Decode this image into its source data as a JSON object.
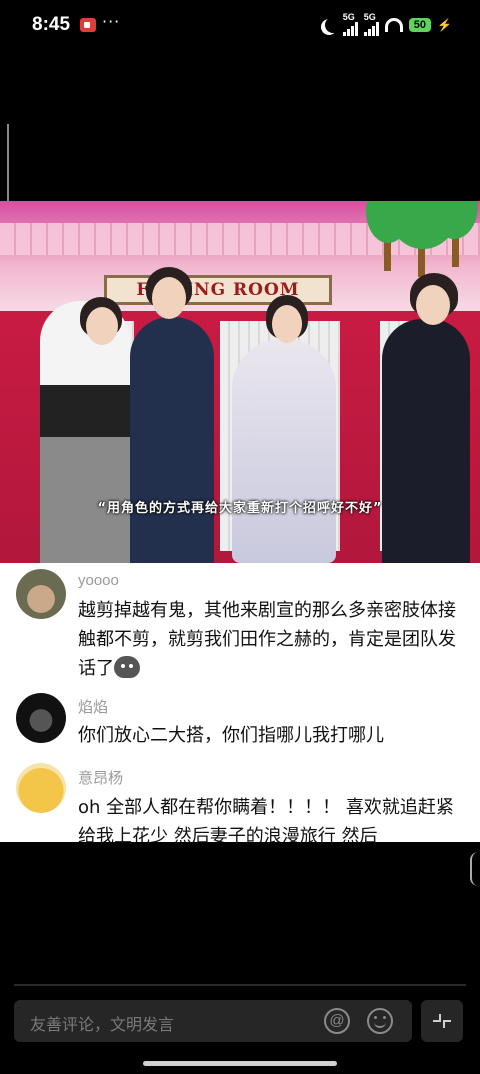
{
  "status_bar": {
    "time": "8:45",
    "dots": "···",
    "signal1_label": "5G",
    "signal2_label": "5G",
    "battery": "50",
    "icons": [
      "recording-icon",
      "moon-icon",
      "signal-icon",
      "wifi-icon",
      "battery-icon",
      "charging-icon"
    ]
  },
  "video": {
    "sign_text": "FITTING ROOM",
    "subtitle": "“用角色的方式再给大家重新打个招呼好不好”",
    "colors": {
      "backdrop": "#d64ea0",
      "wall": "#c81b43"
    }
  },
  "comments": [
    {
      "user": "yoooo",
      "text": "越剪掉越有鬼，其他来剧宣的那么多亲密肢体接触都不剪，就剪我们田作之赫的，肯定是团队发话了",
      "emoji": "sticker-emoji"
    },
    {
      "user": "焰焰",
      "text": "你们放心二大搭，你们指哪儿我打哪儿"
    },
    {
      "user": "意昂杨",
      "text": "oh 全部人都在帮你瞒着！！！！ 喜欢就追赶紧给我上花少 然后妻子的浪漫旅行 然后"
    }
  ],
  "input": {
    "placeholder": "友善评论，文明发言",
    "at_label": "@"
  }
}
